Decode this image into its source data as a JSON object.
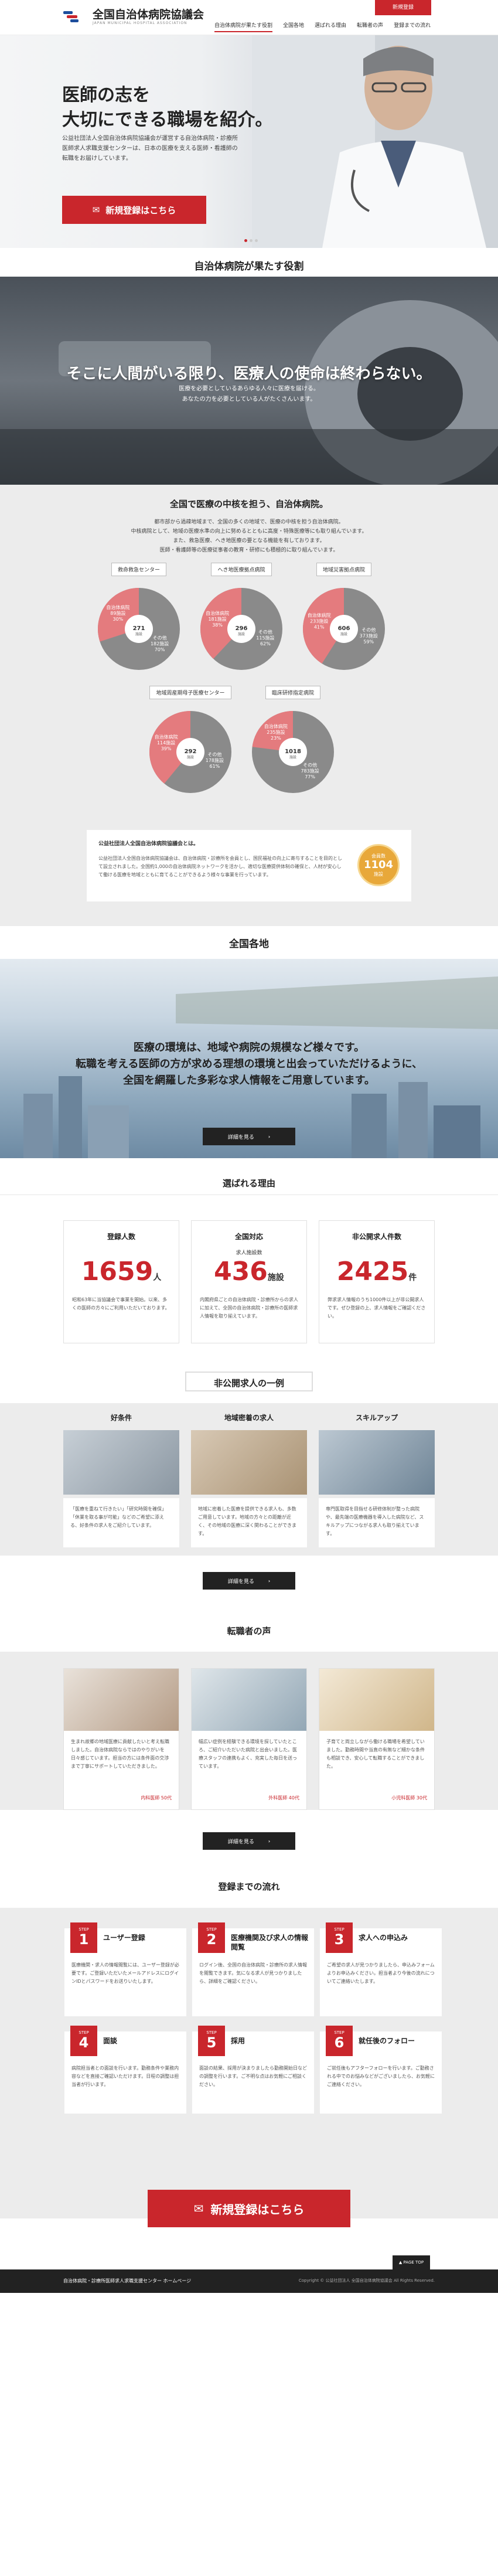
{
  "header": {
    "logo_title": "全国自治体病院協議会",
    "logo_sub": "JAPAN MUNICIPAL HOSPITAL ASSOCIATION",
    "nav": [
      "自治体病院が果たす役割",
      "全国各地",
      "選ばれる理由",
      "転職者の声",
      "登録までの流れ"
    ],
    "register_button": "新規登録"
  },
  "hero": {
    "headline_1": "医師の志を",
    "headline_2": "大切にできる職場を紹介。",
    "text": "公益社団法人全国自治体病院協議会が運営する自治体病院・診療所医師求人求職支援センターは、日本の医療を支える医師・看護師の転職をお届けしています。",
    "cta": "新規登録はこちら"
  },
  "role": {
    "title": "自治体病院が果たす役割",
    "band_title": "そこに人間がいる限り、医療人の使命は終わらない。",
    "band_sub_1": "医療を必要としているあらゆる人々に医療を届ける。",
    "band_sub_2": "あなたの力を必要としている人がたくさんいます。",
    "core_title": "全国で医療の中核を担う、自治体病院。",
    "core_text_1": "都市部から過疎地域まで、全国の多くの地域で、医療の中核を担う自治体病院。",
    "core_text_2": "中核病院として、地域の医療水準の向上に努めるとともに高度・特殊医療等にも取り組んでいます。",
    "core_text_3": "また、救急医療、へき地医療の要となる機能を有しております。",
    "core_text_4": "医師・看護師等の医療従事者の教育・研修にも積極的に取り組んでいます。"
  },
  "pies": [
    {
      "label": "救命救急センター",
      "share": "30%",
      "share_name": "自治体病院",
      "count": "89施設",
      "center": "271",
      "center_sub": "施設",
      "other_name": "その他",
      "other_count": "182施設",
      "other_share": "70%"
    },
    {
      "label": "へき地医療拠点病院",
      "share": "38%",
      "share_name": "自治体病院",
      "count": "181施設",
      "center": "296",
      "center_sub": "施設",
      "other_name": "その他",
      "other_count": "115施設",
      "other_share": "62%"
    },
    {
      "label": "地域災害拠点病院",
      "share": "41%",
      "share_name": "自治体病院",
      "count": "233施設",
      "center": "606",
      "center_sub": "施設",
      "other_name": "その他",
      "other_count": "373施設",
      "other_share": "59%"
    },
    {
      "label": "地域周産期母子医療センター",
      "share": "39%",
      "share_name": "自治体病院",
      "count": "114施設",
      "center": "292",
      "center_sub": "施設",
      "other_name": "その他",
      "other_count": "178施設",
      "other_share": "61%"
    },
    {
      "label": "臨床研修指定病院",
      "share": "23%",
      "share_name": "自治体病院",
      "count": "235施設",
      "center": "1018",
      "center_sub": "施設",
      "other_name": "その他",
      "other_count": "783施設",
      "other_share": "77%"
    }
  ],
  "pie_colors": {
    "share": "#e47b7e",
    "other": "#8a8a8a"
  },
  "assoc": {
    "title": "公益社団法人全国自治体病院協議会とは。",
    "text": "公益社団法人全国自治体病院協議会は、自治体病院・診療所を会員とし、国民福祉の向上に寄与することを目的として設立されました。全国約1,000の自治体病院ネットワークを活かし、適切な医療提供体制の確保と、人材が安心して働ける医療を地域とともに育てることができるよう様々な事業を行っています。",
    "badge_top": "会員数",
    "badge_num": "1104",
    "badge_unit": "施設"
  },
  "areas": {
    "title": "全国各地",
    "line_1": "医療の環境は、地域や病院の規模など様々です。",
    "line_2": "転職を考える医師の方が求める理想の環境と出会っていただけるように、",
    "line_3": "全国を網羅した多彩な求人情報をご用意しています。",
    "button": "詳細を見る"
  },
  "reasons": {
    "title": "選ばれる理由",
    "cards": [
      {
        "title": "登録人数",
        "prefix": "",
        "number": "1659",
        "unit": "人",
        "text": "昭和63年に当協議会で事業を開始。以来、多くの医師の方々にご利用いただいております。"
      },
      {
        "title": "全国対応",
        "prefix": "求人施設数",
        "number": "436",
        "unit": "施設",
        "text": "内閣府県ごとの自治体病院・診療所からの求人に加えて、全国の自治体病院・診療所の医師求人情報を取り揃えています。"
      },
      {
        "title": "非公開求人件数",
        "prefix": "",
        "number": "2425",
        "unit": "件",
        "text": "弊求求人情報のうち1000件以上が非公開求人です。ぜひ登録の上、求人情報をご確認ください。"
      }
    ]
  },
  "private": {
    "title": "非公開求人の一例",
    "cards": [
      {
        "title": "好条件",
        "text": "「医療を重ねて行きたい」「研究時間を確保」「休業を取る事が可能」などのご希望に添える、好条件の求人をご紹介しています。"
      },
      {
        "title": "地域密着の求人",
        "text": "地域に密着した医療を提供できる求人も、多数ご用意しています。地域の方々との距離が近く、その地域の医療に深く関わることができます。"
      },
      {
        "title": "スキルアップ",
        "text": "専門医取得を目指せる研修体制が整った病院や、最先端の医療機器を導入した病院など、スキルアップにつながる求人も取り揃えています。"
      }
    ],
    "button": "詳細を見る"
  },
  "voices": {
    "title": "転職者の声",
    "cards": [
      {
        "text": "生まれ故郷の地域医療に貢献したいと考え転職しました。自治体病院ならではのやりがいを日々感じています。担当の方には条件面の交渉まで丁寧にサポートしていただきました。",
        "meta": "内科医師 50代"
      },
      {
        "text": "幅広い症例を経験できる環境を探していたところ、ご紹介いただいた病院と出会いました。医療スタッフの連携もよく、充実した毎日を送っています。",
        "meta": "外科医師 40代"
      },
      {
        "text": "子育てと両立しながら働ける職場を希望していました。勤務時間や当直の有無など細かな条件も相談でき、安心して転職することができました。",
        "meta": "小児科医師 30代"
      }
    ],
    "button": "詳細を見る"
  },
  "flow": {
    "title": "登録までの流れ",
    "steps": [
      {
        "no": "1",
        "label": "STEP",
        "title": "ユーザー登録",
        "text": "医療機関・求人の情報閲覧には、ユーザー登録が必要です。ご登録いただいたメールアドレスにログインIDとパスワードをお送りいたします。"
      },
      {
        "no": "2",
        "label": "STEP",
        "title": "医療機関及び求人の情報閲覧",
        "text": "ログイン後、全国の自治体病院・診療所の求人情報を閲覧できます。気になる求人が見つかりましたら、詳細をご確認ください。"
      },
      {
        "no": "3",
        "label": "STEP",
        "title": "求人への申込み",
        "text": "ご希望の求人が見つかりましたら、申込みフォームよりお申込みください。担当者より今後の流れについてご連絡いたします。"
      },
      {
        "no": "4",
        "label": "STEP",
        "title": "面談",
        "text": "病院担当者との面談を行います。勤務条件や業務内容などを直接ご確認いただけます。日程の調整は担当者が行います。"
      },
      {
        "no": "5",
        "label": "STEP",
        "title": "採用",
        "text": "面談の結果、採用が決まりましたら勤務開始日などの調整を行います。ご不明な点はお気軽にご相談ください。"
      },
      {
        "no": "6",
        "label": "STEP",
        "title": "就任後のフォロー",
        "text": "ご就任後もアフターフォローを行います。ご勤務される中でのお悩みなどがございましたら、お気軽にご連絡ください。"
      }
    ]
  },
  "bottom_cta": "新規登録はこちら",
  "page_top": "PAGE TOP",
  "footer": {
    "left": "自治体病院・診療所医師求人求職支援センター ホームページ",
    "right": "Copyright © 公益社団法人 全国自治体病院協議会 All Rights Reserved."
  },
  "colors": {
    "accent": "#c9262c",
    "dark": "#222222",
    "gray_bg": "#ececec"
  }
}
